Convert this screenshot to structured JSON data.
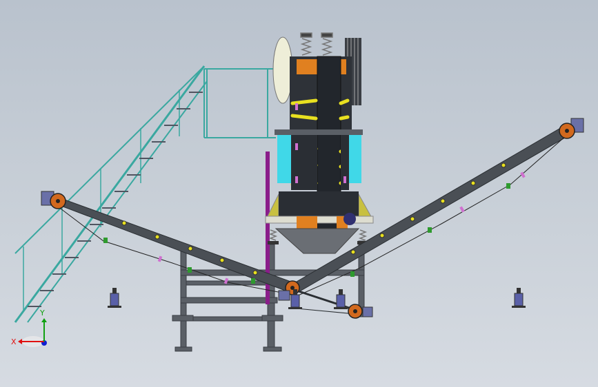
{
  "viewport": {
    "background_top": "#b9c2cd",
    "background_bottom": "#d6dbe2"
  },
  "triad": {
    "x_label": "X",
    "y_label": "Y",
    "x_color": "#e01010",
    "y_color": "#10a010",
    "z_color": "#1020d0"
  },
  "colors": {
    "steel": "#5a5f66",
    "belt": "#4a4f55",
    "railing": "#3aa8a0",
    "pulley": "#d2691e",
    "motor": "#6a70a8",
    "spring": "#d070d0",
    "highlight": "#e8e020",
    "cyan_panel": "#40d8e8"
  },
  "icons": [
    "view-triad-icon"
  ]
}
